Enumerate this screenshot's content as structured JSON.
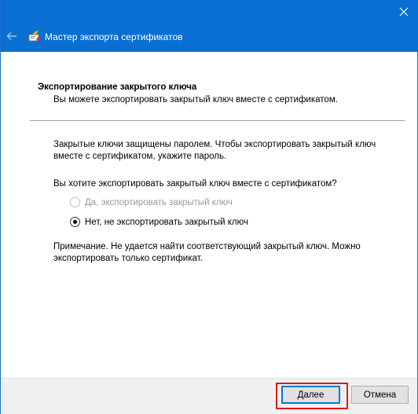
{
  "window": {
    "title": "Мастер экспорта сертификатов"
  },
  "header": {
    "title": "Экспортирование закрытого ключа",
    "subtitle": "Вы можете экспортировать закрытый ключ вместе с сертификатом."
  },
  "body": {
    "paragraph1": "Закрытые ключи защищены паролем. Чтобы экспортировать закрытый ключ вместе с сертификатом, укажите пароль.",
    "question": "Вы хотите экспортировать закрытый ключ вместе с сертификатом?",
    "options": [
      {
        "label": "Да, экспортировать закрытый ключ",
        "selected": false,
        "enabled": false
      },
      {
        "label": "Нет, не экспортировать закрытый ключ",
        "selected": true,
        "enabled": true
      }
    ],
    "note": "Примечание. Не удается найти соответствующий закрытый ключ. Можно экспортировать только сертификат."
  },
  "footer": {
    "next_label": "Далее",
    "cancel_label": "Отмена"
  },
  "icons": {
    "close": "close-icon",
    "back": "back-arrow-icon",
    "wizard": "certificate-wizard-icon"
  },
  "colors": {
    "titlebar": "#0a6fd2",
    "highlight": "#e01a1a",
    "default_button_border": "#0078d7"
  }
}
